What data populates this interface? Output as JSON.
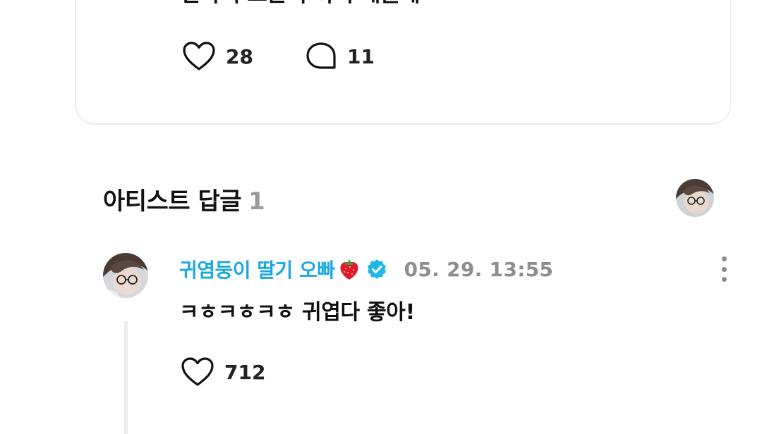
{
  "post": {
    "text": "안아서 드는거 까지 해줄게",
    "likes": "28",
    "comments": "11"
  },
  "section": {
    "title": "아티스트 답글",
    "count": "1"
  },
  "reply": {
    "author": "귀염둥이 딸기 오빠",
    "timestamp": "05. 29. 13:55",
    "text": "ㅋㅎㅋㅎㅋㅎ 귀엽다 좋아!",
    "likes": "712",
    "verified_color": "#1fb8e6",
    "author_color": "#1aa8e0"
  },
  "icons": [
    "heart-icon",
    "comment-bubble-icon",
    "strawberry-icon",
    "verified-badge-icon",
    "more-vertical-icon"
  ]
}
